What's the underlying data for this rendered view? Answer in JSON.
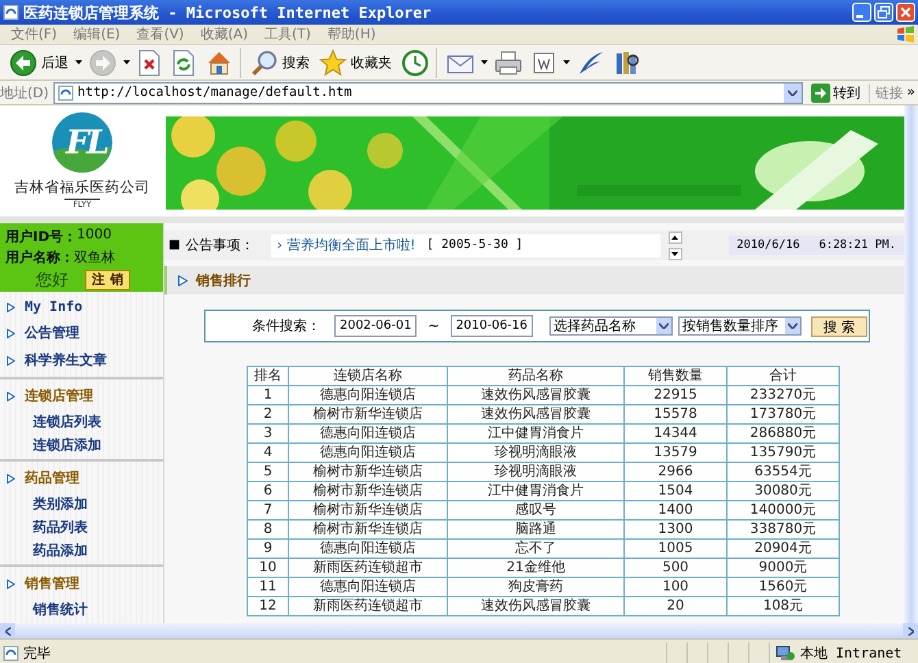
{
  "window": {
    "title": "医药连锁店管理系统 - Microsoft Internet Explorer"
  },
  "menu_bar": [
    "文件(F)",
    "编辑(E)",
    "查看(V)",
    "收藏(A)",
    "工具(T)",
    "帮助(H)"
  ],
  "toolbar_groups": [
    {
      "buttons": [
        {
          "kind": "back",
          "label": "后退",
          "dropdown": true,
          "disabled": false
        },
        {
          "kind": "forward",
          "dropdown": true,
          "disabled": true
        },
        {
          "kind": "stop",
          "dropdown": false,
          "disabled": false
        },
        {
          "kind": "refresh",
          "dropdown": false,
          "disabled": false
        },
        {
          "kind": "home",
          "dropdown": false,
          "disabled": false
        }
      ]
    },
    {
      "buttons": [
        {
          "kind": "search",
          "label": "搜索",
          "dropdown": false,
          "disabled": false
        },
        {
          "kind": "favorites",
          "label": "收藏夹",
          "dropdown": false,
          "disabled": false
        },
        {
          "kind": "media",
          "dropdown": false,
          "disabled": false
        }
      ]
    },
    {
      "buttons": [
        {
          "kind": "mail",
          "dropdown": true,
          "disabled": false
        },
        {
          "kind": "print",
          "dropdown": false,
          "disabled": false
        },
        {
          "kind": "edit",
          "dropdown": true,
          "disabled": false
        },
        {
          "kind": "discuss",
          "dropdown": false,
          "disabled": false
        },
        {
          "kind": "research",
          "dropdown": false,
          "disabled": false
        }
      ]
    }
  ],
  "address_bar": {
    "label": "地址(D)",
    "url": "http://localhost/manage/default.htm",
    "go": "转到",
    "links": "链接",
    "more": "»"
  },
  "logo": {
    "mark": "FL",
    "company": "吉林省福乐医药公司",
    "tagline": "FLYY"
  },
  "user_panel": {
    "id_label": "用户ID号：",
    "id": "1000",
    "name_label": "用户名称：",
    "name": "双鱼林",
    "greeting": "您好",
    "logout": "注 销"
  },
  "nav": [
    {
      "label": "My Info",
      "kind": "item"
    },
    {
      "label": "公告管理",
      "kind": "item"
    },
    {
      "label": "科学养生文章",
      "kind": "item"
    },
    {
      "label": "连锁店管理",
      "kind": "section"
    },
    {
      "label": "连锁店列表",
      "kind": "sub"
    },
    {
      "label": "连锁店添加",
      "kind": "sub"
    },
    {
      "label": "药品管理",
      "kind": "section"
    },
    {
      "label": "类别添加",
      "kind": "sub"
    },
    {
      "label": "药品列表",
      "kind": "sub"
    },
    {
      "label": "药品添加",
      "kind": "sub"
    },
    {
      "label": "销售管理",
      "kind": "section"
    },
    {
      "label": "销售统计",
      "kind": "sub"
    }
  ],
  "notice": {
    "bullet": "■",
    "label": "公告事项：",
    "items": [
      {
        "marker": "›",
        "title": "营养均衡全面上市啦!",
        "date": "[ 2005-5-30 ]"
      }
    ],
    "date": "2010/6/16",
    "time": "6:28:21 PM."
  },
  "section_title": "销售排行",
  "search_form": {
    "label": "条件搜索：",
    "from": "2002-06-01",
    "separator": "~",
    "to": "2010-06-16",
    "drug_select": "选择药品名称",
    "sort_select": "按销售数量排序",
    "button": "搜 索"
  },
  "table": {
    "columns": [
      "排名",
      "连锁店名称",
      "药品名称",
      "销售数量",
      "合计"
    ],
    "rows": [
      [
        "1",
        "德惠向阳连锁店",
        "速效伤风感冒胶囊",
        "22915",
        "233270元"
      ],
      [
        "2",
        "榆树市新华连锁店",
        "速效伤风感冒胶囊",
        "15578",
        "173780元"
      ],
      [
        "3",
        "德惠向阳连锁店",
        "江中健胃消食片",
        "14344",
        "286880元"
      ],
      [
        "4",
        "德惠向阳连锁店",
        "珍视明滴眼液",
        "13579",
        "135790元"
      ],
      [
        "5",
        "榆树市新华连锁店",
        "珍视明滴眼液",
        "2966",
        "63554元"
      ],
      [
        "6",
        "榆树市新华连锁店",
        "江中健胃消食片",
        "1504",
        "30080元"
      ],
      [
        "7",
        "榆树市新华连锁店",
        "感叹号",
        "1400",
        "140000元"
      ],
      [
        "8",
        "榆树市新华连锁店",
        "脑路通",
        "1300",
        "338780元"
      ],
      [
        "9",
        "德惠向阳连锁店",
        "忘不了",
        "1005",
        "20904元"
      ],
      [
        "10",
        "新雨医药连锁超市",
        "21金维他",
        "500",
        "9000元"
      ],
      [
        "11",
        "德惠向阳连锁店",
        "狗皮膏药",
        "100",
        "1560元"
      ],
      [
        "12",
        "新雨医药连锁超市",
        "速效伤风感冒胶囊",
        "20",
        "108元"
      ]
    ]
  },
  "status_bar": {
    "text": "完毕",
    "zone": "本地 Intranet"
  }
}
